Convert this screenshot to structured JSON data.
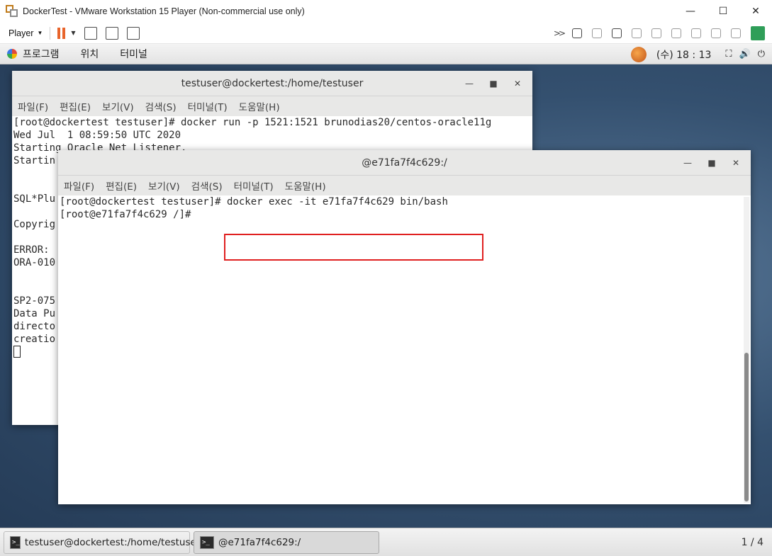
{
  "vmware": {
    "title": "DockerTest - VMware Workstation 15 Player (Non-commercial use only)",
    "player_menu": "Player",
    "window_controls": [
      "—",
      "☐",
      "✕"
    ]
  },
  "gnome": {
    "menus": [
      "프로그램",
      "위치",
      "터미널"
    ],
    "clock": "(수) 18 : 13"
  },
  "term1": {
    "title": "testuser@dockertest:/home/testuser",
    "menu": [
      "파일(F)",
      "편집(E)",
      "보기(V)",
      "검색(S)",
      "터미널(T)",
      "도움말(H)"
    ],
    "lines": [
      "[root@dockertest testuser]# docker run -p 1521:1521 brunodias20/centos-oracle11g",
      "Wed Jul  1 08:59:50 UTC 2020",
      "Starting Oracle Net Listener.",
      "Startin",
      "",
      "",
      "SQL*Plu",
      "",
      "Copyrig",
      "",
      "ERROR:",
      "ORA-010",
      "",
      "",
      "SP2-075",
      "Data Pu",
      "directo",
      "creatio"
    ]
  },
  "term2": {
    "title": "@e71fa7f4c629:/",
    "menu": [
      "파일(F)",
      "편집(E)",
      "보기(V)",
      "검색(S)",
      "터미널(T)",
      "도움말(H)"
    ],
    "lines": [
      "[root@dockertest testuser]# docker exec -it e71fa7f4c629 bin/bash",
      "[root@e71fa7f4c629 /]# "
    ]
  },
  "taskbar": {
    "items": [
      "testuser@dockertest:/home/testuser",
      "@e71fa7f4c629:/"
    ],
    "pager": "1 / 4"
  },
  "colors": {
    "highlight_box": "#e02020",
    "pause_orange": "#e8642b"
  }
}
